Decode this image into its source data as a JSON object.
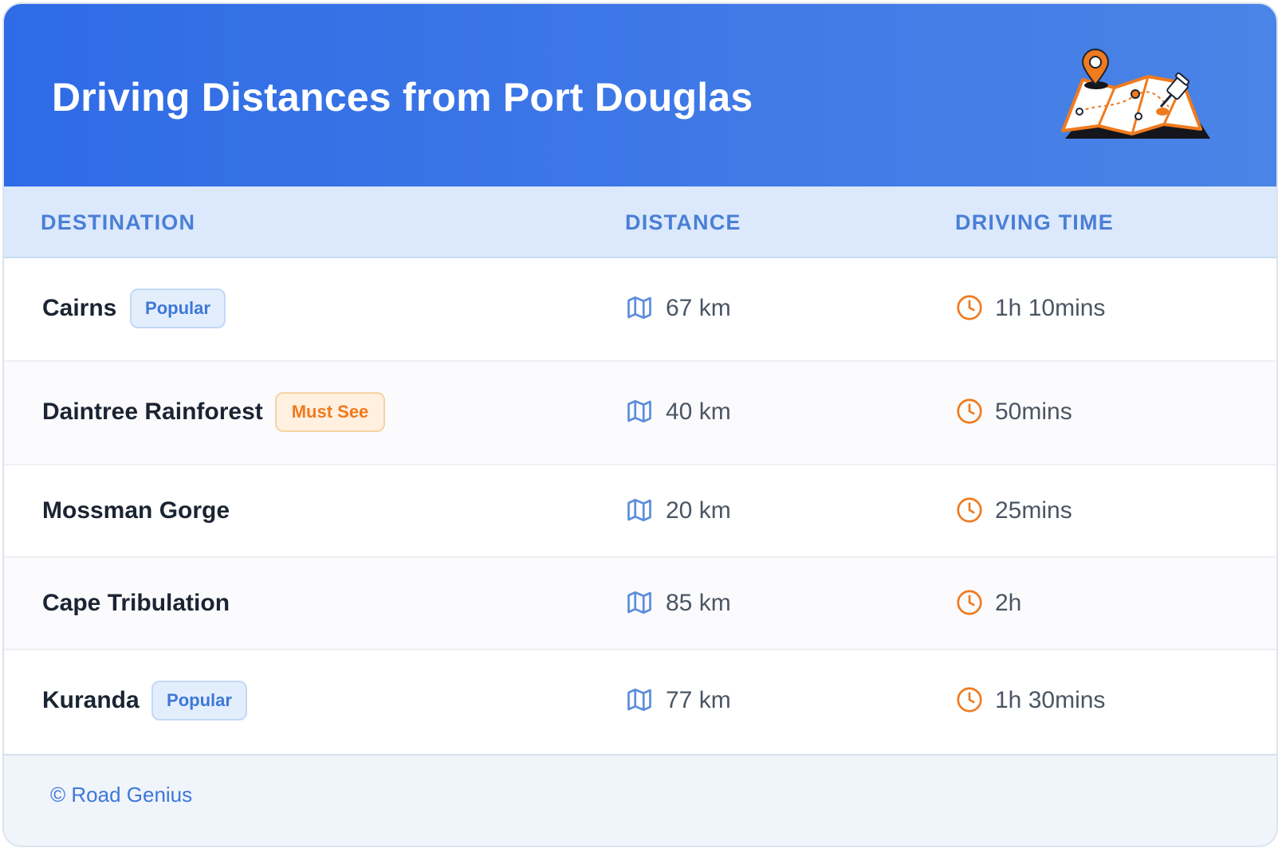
{
  "header": {
    "title": "Driving Distances from Port Douglas",
    "illustration_icon": "map-with-pins-icon",
    "gradient_colors": [
      "#2f6be6",
      "#4a84e6"
    ]
  },
  "table": {
    "columns": [
      "DESTINATION",
      "DISTANCE",
      "DRIVING TIME"
    ],
    "distance_icon": "map-icon",
    "time_icon": "clock-icon",
    "rows": [
      {
        "destination": "Cairns",
        "badge": "Popular",
        "badge_type": "popular",
        "distance": "67 km",
        "time": "1h 10mins"
      },
      {
        "destination": "Daintree Rainforest",
        "badge": "Must See",
        "badge_type": "mustsee",
        "distance": "40 km",
        "time": "50mins"
      },
      {
        "destination": "Mossman Gorge",
        "badge": "",
        "badge_type": "",
        "distance": "20 km",
        "time": "25mins"
      },
      {
        "destination": "Cape Tribulation",
        "badge": "",
        "badge_type": "",
        "distance": "85 km",
        "time": "2h"
      },
      {
        "destination": "Kuranda",
        "badge": "Popular",
        "badge_type": "popular",
        "distance": "77 km",
        "time": "1h 30mins"
      }
    ]
  },
  "footer": {
    "copyright": "© Road Genius"
  },
  "colors": {
    "accent_blue": "#3d78d8",
    "accent_orange": "#f07a1e",
    "header_row_bg": "#dce9fc"
  }
}
